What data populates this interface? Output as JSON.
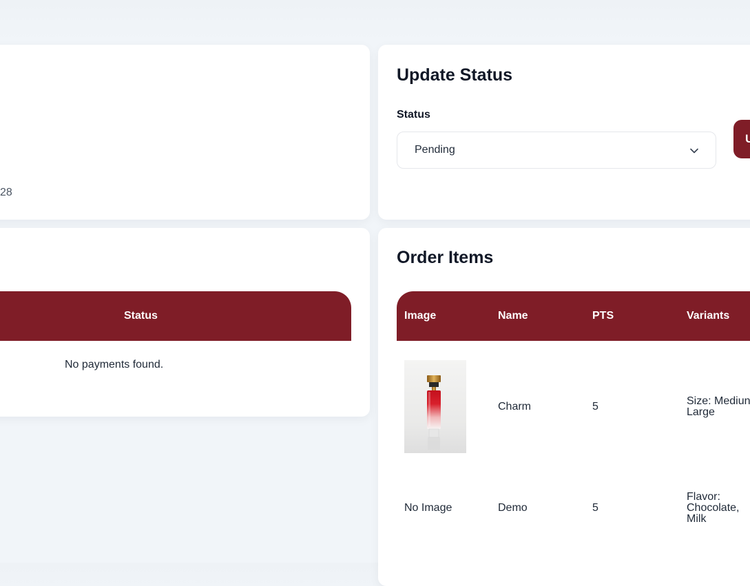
{
  "order_info": {
    "partial_number": "28"
  },
  "update_status": {
    "title": "Update Status",
    "status_label": "Status",
    "status_value": "Pending",
    "update_button_label": "U"
  },
  "payments": {
    "columns": [
      "Status"
    ],
    "empty_message": "No payments found."
  },
  "order_items": {
    "title": "Order Items",
    "columns": [
      "Image",
      "Name",
      "PTS",
      "Variants"
    ],
    "rows": [
      {
        "image": "perfume-bottle",
        "name": "Charm",
        "pts": "5",
        "variants_lines": [
          "Size: Mediun",
          "Large"
        ]
      },
      {
        "image_text": "No Image",
        "name": "Demo",
        "pts": "5",
        "variants_lines": [
          "Flavor:",
          "Chocolate,",
          "Milk"
        ]
      }
    ]
  },
  "colors": {
    "brand": "#7f1d27",
    "background": "#f1f5f9",
    "card": "#ffffff"
  }
}
